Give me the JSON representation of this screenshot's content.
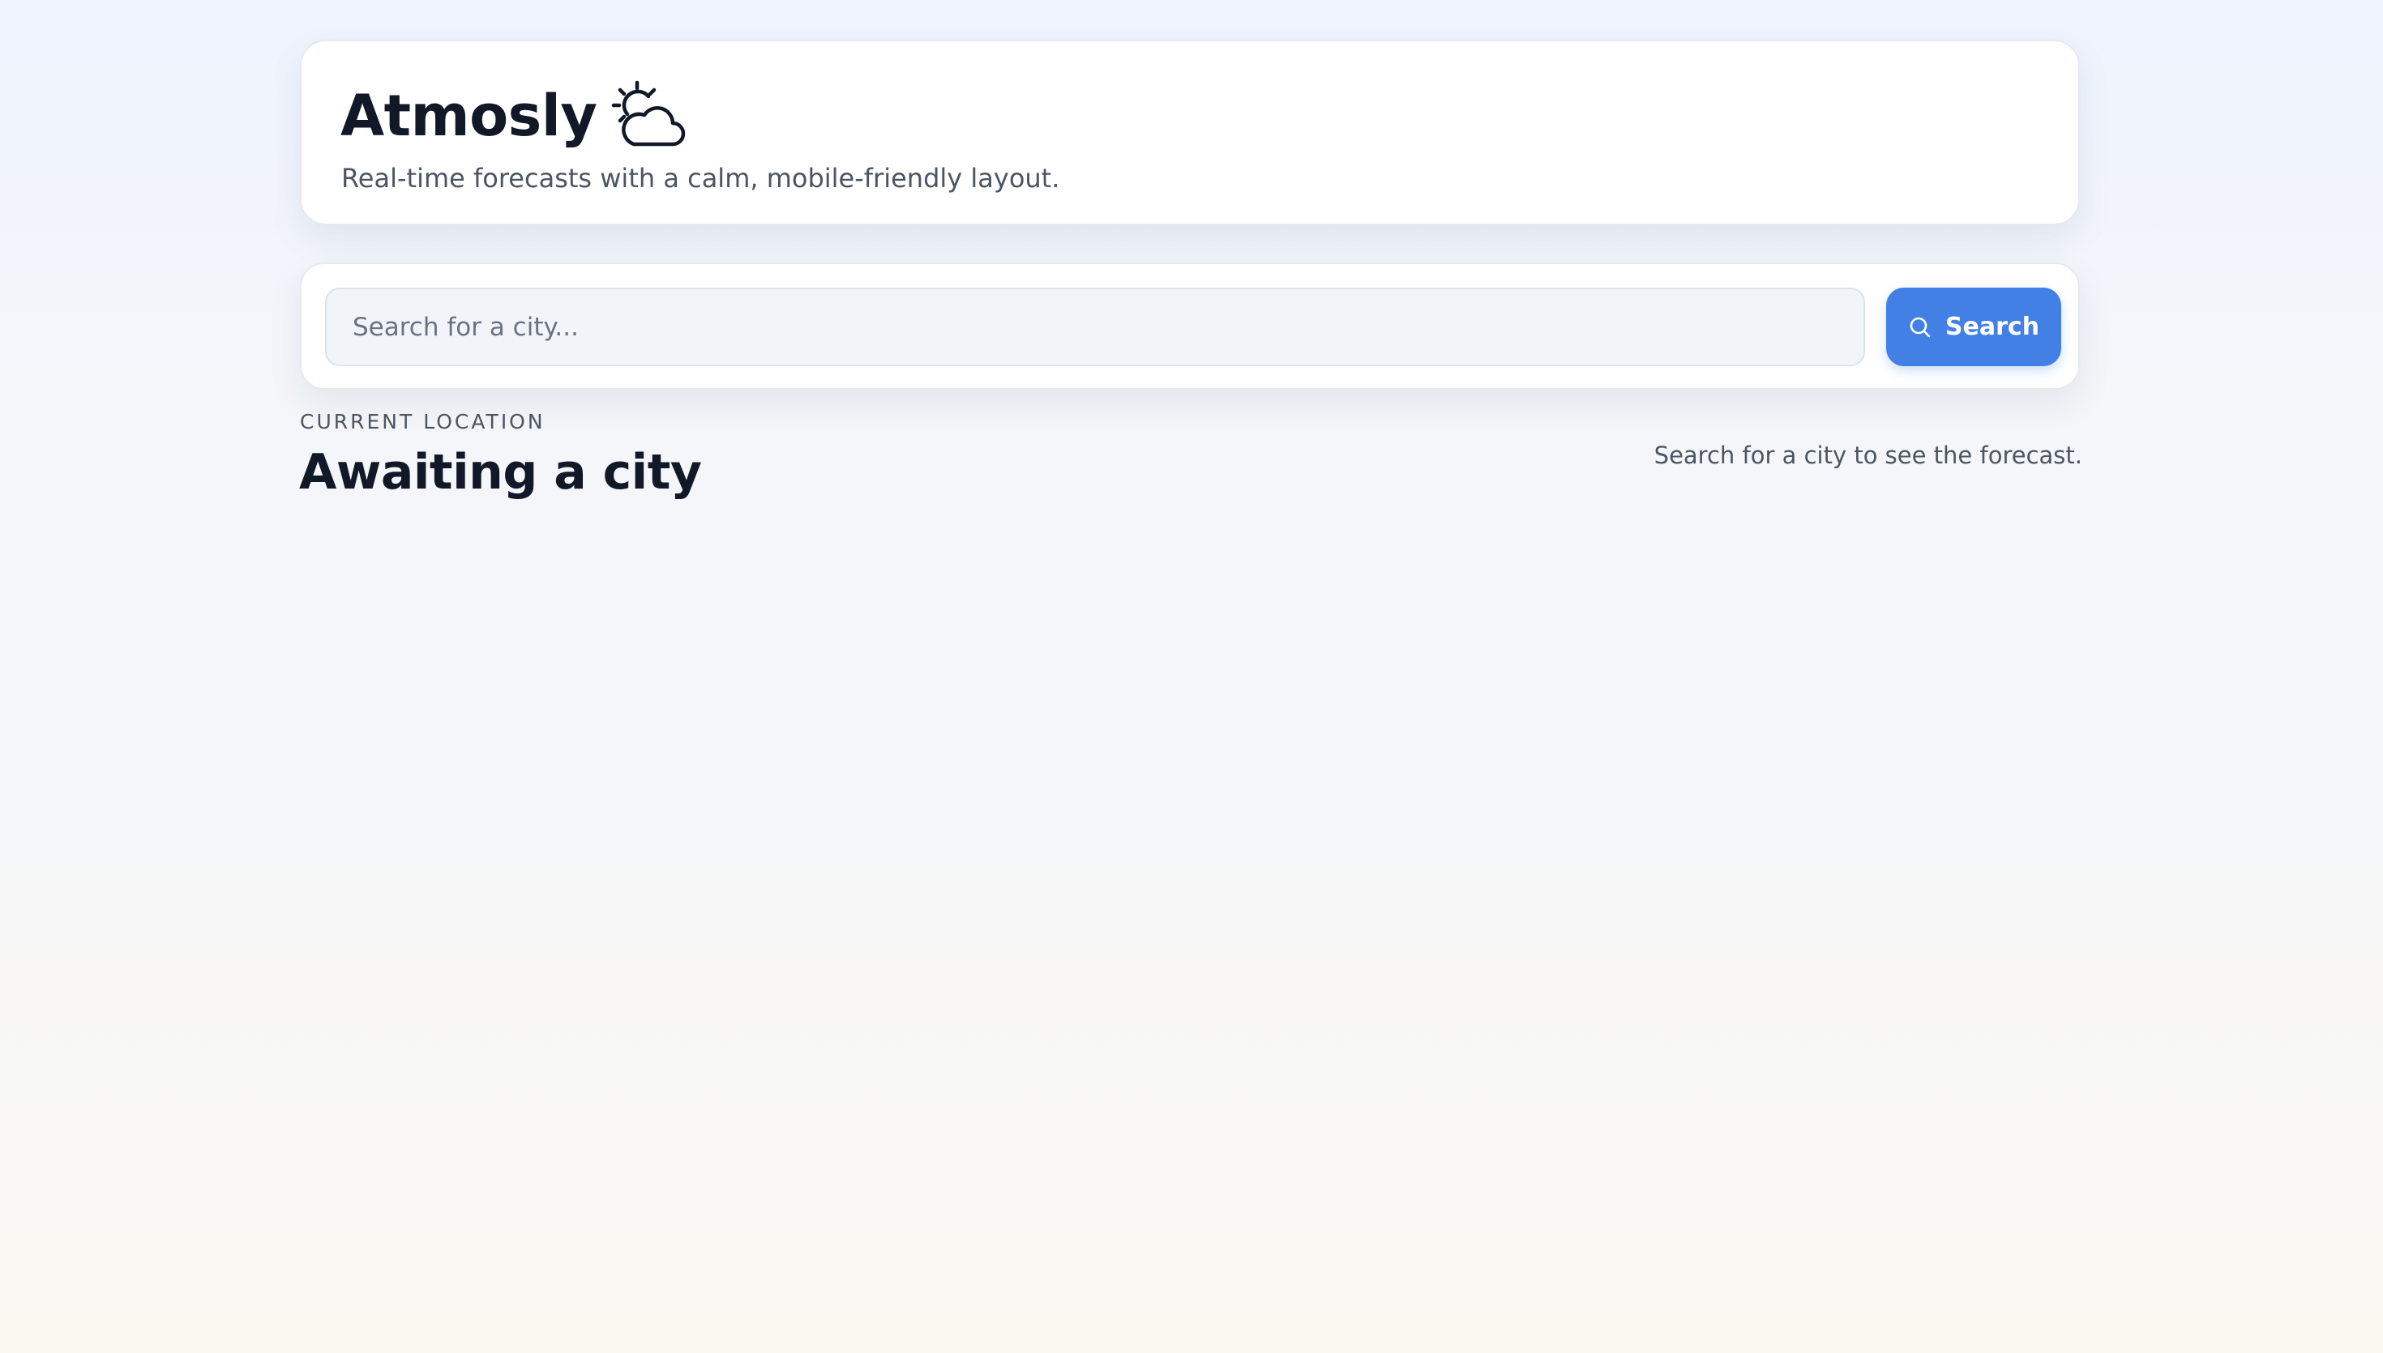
{
  "header": {
    "app_title": "Atmosly",
    "title_icon": "sun-behind-cloud-icon",
    "subtitle": "Real-time forecasts with a calm, mobile-friendly layout."
  },
  "search": {
    "placeholder": "Search for a city...",
    "value": "",
    "button_label": "Search",
    "button_icon": "search-icon",
    "accent_color": "#4380e6"
  },
  "location": {
    "label": "CURRENT LOCATION",
    "name": "Awaiting a city",
    "hint": "Search for a city to see the forecast."
  }
}
